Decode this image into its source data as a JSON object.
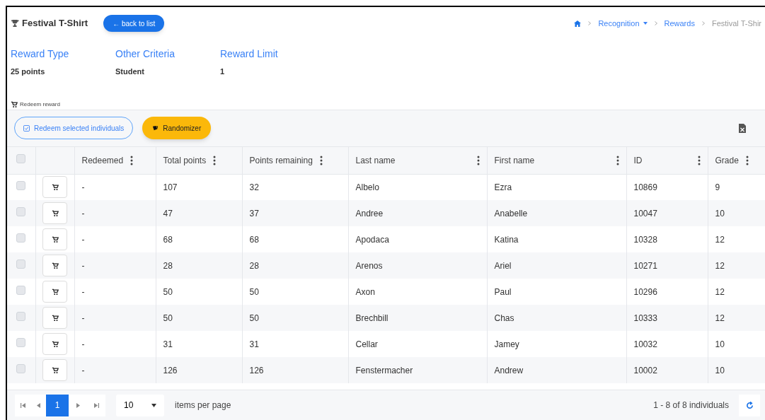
{
  "header": {
    "title": "Festival T-Shirt",
    "back_button": "← back to list"
  },
  "breadcrumb": [
    {
      "label": "Recognition",
      "dropdown": true,
      "current": false
    },
    {
      "label": "Rewards",
      "dropdown": false,
      "current": false
    },
    {
      "label": "Festival T-Shir",
      "dropdown": false,
      "current": true
    }
  ],
  "details": [
    {
      "label": "Reward Type",
      "value": "25 points"
    },
    {
      "label": "Other Criteria",
      "value": "Student"
    },
    {
      "label": "Reward Limit",
      "value": "1"
    }
  ],
  "section_title": "Redeem reward",
  "toolbar": {
    "redeem_button": "Redeem selected individuals",
    "randomizer_button": "Randomizer"
  },
  "table": {
    "select_all_checked": false,
    "columns": [
      "Redeemed",
      "Total points",
      "Points remaining",
      "Last name",
      "First name",
      "ID",
      "Grade"
    ],
    "rows": [
      {
        "checked": false,
        "cells": [
          "-",
          "107",
          "32",
          "Albelo",
          "Ezra",
          "10869",
          "9"
        ]
      },
      {
        "checked": false,
        "cells": [
          "-",
          "47",
          "37",
          "Andree",
          "Anabelle",
          "10047",
          "10"
        ]
      },
      {
        "checked": false,
        "cells": [
          "-",
          "68",
          "68",
          "Apodaca",
          "Katina",
          "10328",
          "12"
        ]
      },
      {
        "checked": false,
        "cells": [
          "-",
          "28",
          "28",
          "Arenos",
          "Ariel",
          "10271",
          "12"
        ]
      },
      {
        "checked": false,
        "cells": [
          "-",
          "50",
          "50",
          "Axon",
          "Paul",
          "10296",
          "12"
        ]
      },
      {
        "checked": false,
        "cells": [
          "-",
          "50",
          "50",
          "Brechbill",
          "Chas",
          "10333",
          "12"
        ]
      },
      {
        "checked": false,
        "cells": [
          "-",
          "31",
          "31",
          "Cellar",
          "Jamey",
          "10032",
          "10"
        ]
      },
      {
        "checked": false,
        "cells": [
          "-",
          "126",
          "126",
          "Fenstermacher",
          "Andrew",
          "10002",
          "10"
        ]
      }
    ]
  },
  "pager": {
    "pages": [
      {
        "label": "1",
        "selected": true
      }
    ],
    "page_size": "10",
    "page_size_label": "items per page",
    "summary": "1 - 8 of 8 individuals"
  }
}
